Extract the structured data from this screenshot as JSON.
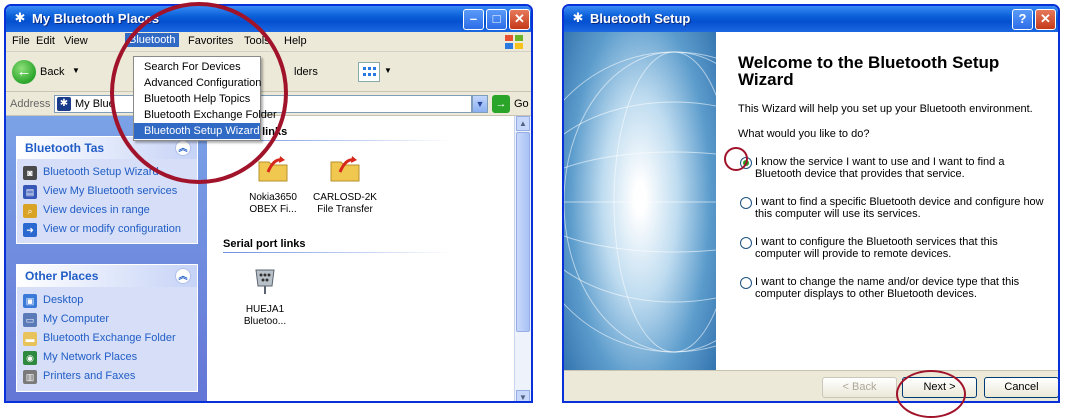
{
  "left_window": {
    "title": "My Bluetooth Places",
    "menu": [
      "File",
      "Edit",
      "View",
      "Bluetooth",
      "Favorites",
      "Tools",
      "Help"
    ],
    "toolbar": {
      "back_label": "Back",
      "folders_label": "lders"
    },
    "address": {
      "label": "Address",
      "value": "My Blue",
      "go_label": "Go"
    },
    "dropdown": {
      "items": [
        "Search For Devices",
        "Advanced Configuration",
        "Bluetooth Help Topics",
        "Bluetooth Exchange Folder",
        "Bluetooth Setup Wizard"
      ]
    },
    "bluetooth_tasks": {
      "title": "Bluetooth Tas",
      "items": [
        "Bluetooth Setup Wizard",
        "View My Bluetooth services",
        "View devices in range",
        "View or modify configuration"
      ]
    },
    "other_places": {
      "title": "Other Places",
      "items": [
        "Desktop",
        "My Computer",
        "Bluetooth Exchange Folder",
        "My Network Places",
        "Printers and Faxes"
      ]
    },
    "groups": {
      "transfer_title": "fer links",
      "serial_title": "Serial port links"
    },
    "files": [
      {
        "line1": "Nokia3650",
        "line2": "OBEX Fi..."
      },
      {
        "line1": "CARLOSD-2K",
        "line2": "File Transfer"
      },
      {
        "line1": "HUEJA1",
        "line2": "Bluetoo..."
      }
    ]
  },
  "right_window": {
    "title": "Bluetooth Setup",
    "heading": "Welcome to the Bluetooth Setup Wizard",
    "intro": "This Wizard will help you set up your Bluetooth environment.",
    "question": "What would you like to do?",
    "options": [
      {
        "text": "I know the service I want to use and I want to find a Bluetooth device that provides that service.",
        "selected": true
      },
      {
        "text": "I want to find a specific Bluetooth device and configure how this computer will use its services.",
        "selected": false
      },
      {
        "text": "I want to configure the Bluetooth services that this computer will provide to remote devices.",
        "selected": false
      },
      {
        "text": "I want to change the name and/or device type that this computer displays to other Bluetooth devices.",
        "selected": false
      }
    ],
    "buttons": {
      "back": "< Back",
      "next": "Next >",
      "cancel": "Cancel"
    }
  },
  "colors": {
    "xp_blue": "#0831d9",
    "annotation_red": "#a1132a",
    "menu_highlight": "#316ac5",
    "task_link": "#215dc6"
  }
}
